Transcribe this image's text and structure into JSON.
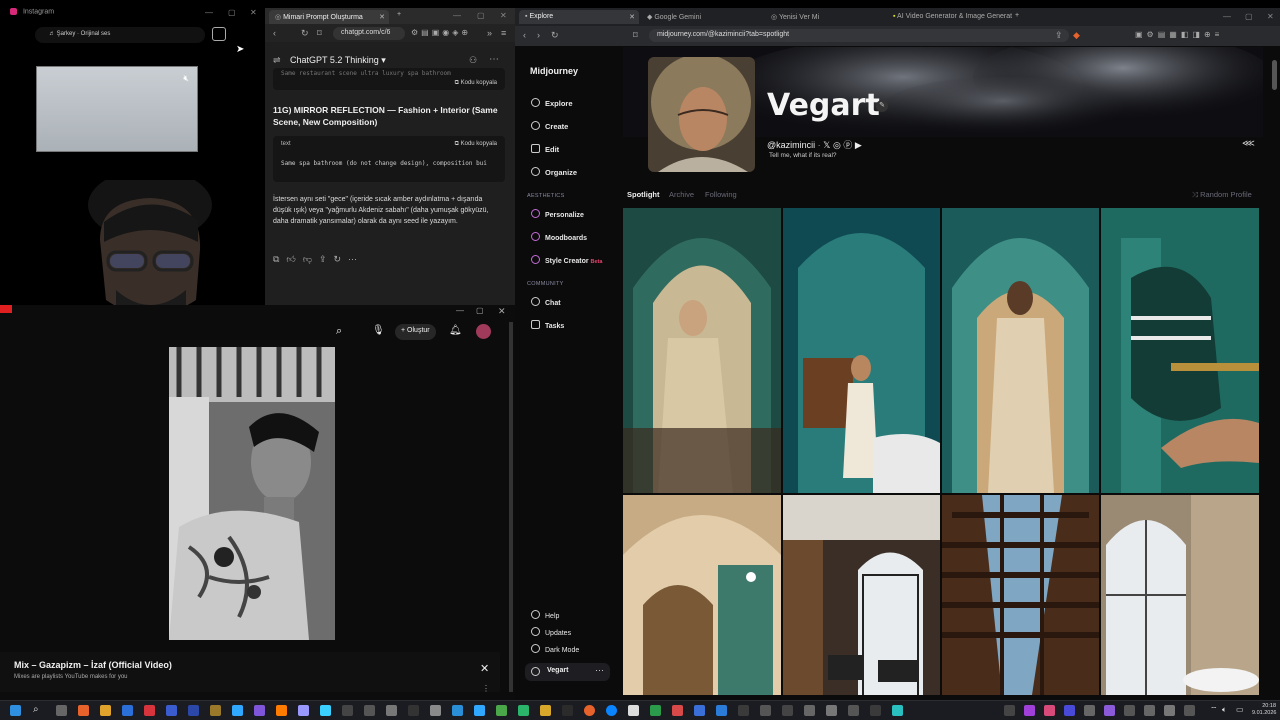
{
  "instagram": {
    "tab_title": "Instagram",
    "audio_label": "♬ Şarkey · Orijinal ses",
    "mute_icon": "speaker-muted-icon"
  },
  "chatgpt": {
    "tab_title": "Mimari Prompt Oluşturma",
    "url": "chatgpt.com/c/6",
    "model": "ChatGPT 5.2 Thinking",
    "copy_label": "Kodu kopyala",
    "heading": "11G) MIRROR REFLECTION — Fashion + Interior (Same Scene, New Composition)",
    "code_lang": "text",
    "code_line": "Same spa bathroom (do not change design), composition bui",
    "paragraph": "İstersen aynı seti \"gece\" (içeride sıcak amber aydınlatma + dışarıda düşük ışık) veya \"yağmurlu Akdeniz sabahı\" (daha yumuşak gökyüzü, daha dramatik yansımalar) olarak da aynı seed ile yazayım."
  },
  "youtube": {
    "create_label": "Oluştur",
    "video_title": "Mix – Gazapizm – İzaf (Official Video)",
    "video_subtitle": "Mixes are playlists YouTube makes for you",
    "close_glyph": "✕"
  },
  "browser": {
    "tabs": [
      "Explore",
      "Google Gemini",
      "Yenisi Ver Mi",
      "AI Video Generator & Image Generat"
    ],
    "url": "midjourney.com/@kazimincii?tab=spotlight"
  },
  "midjourney": {
    "brand": "Midjourney",
    "nav": [
      "Explore",
      "Create",
      "Edit",
      "Organize"
    ],
    "aesthetics_heading": "AESTHETICS",
    "aesthetics": [
      "Personalize",
      "Moodboards",
      "Style Creator"
    ],
    "beta_badge": "Beta",
    "community_heading": "COMMUNITY",
    "community": [
      "Chat",
      "Tasks"
    ],
    "bottom": [
      "Help",
      "Updates",
      "Dark Mode"
    ],
    "profile_label": "Vegart",
    "profile_name": "Vegart",
    "handle": "@kazimincii",
    "tagline": "Tell me, what if its real?",
    "tabs": [
      "Spotlight",
      "Archive",
      "Following"
    ],
    "random_profile": "Random Profile",
    "accent": "#e9436b"
  },
  "taskbar": {
    "time": "20:18",
    "date": "9.01.2026"
  }
}
